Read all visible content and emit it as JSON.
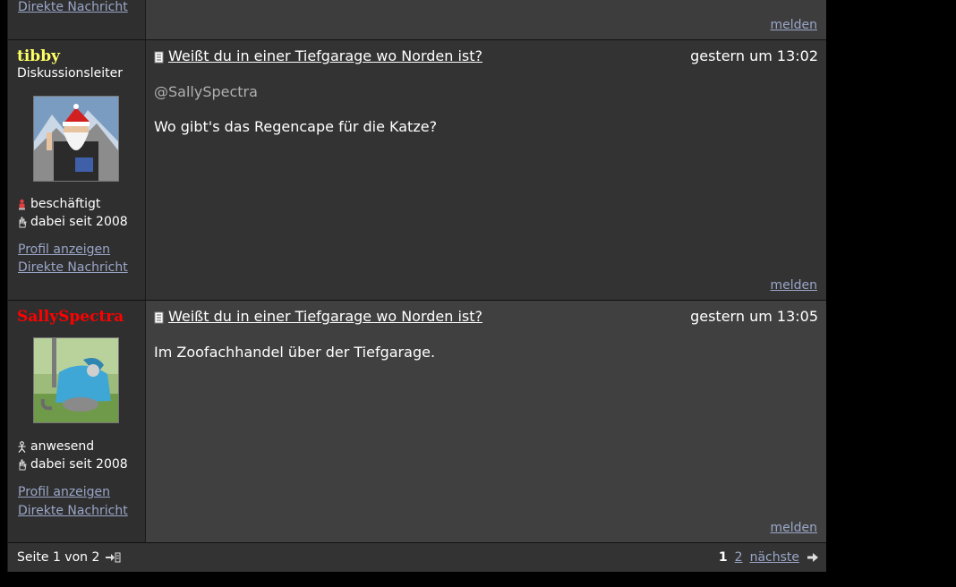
{
  "prev_post": {
    "pm_link": "Direkte Nachricht",
    "report_link": "melden"
  },
  "posts": [
    {
      "username": "tibby",
      "username_color": "#ffff66",
      "rank": "Diskussionsleiter",
      "status": "beschäftigt",
      "status_icon": "busy-person-icon",
      "member_since": "dabei seit 2008",
      "profile_link": "Profil anzeigen",
      "pm_link": "Direkte Nachricht",
      "title": "Weißt du in einer Tiefgarage wo Norden ist?",
      "date": "gestern um 13:02",
      "mention": "@SallySpectra",
      "text": "Wo gibt's das Regencape für die Katze?",
      "report_link": "melden"
    },
    {
      "username": "SallySpectra",
      "username_color": "#ff0000",
      "status": "anwesend",
      "status_icon": "present-person-icon",
      "member_since": "dabei seit 2008",
      "profile_link": "Profil anzeigen",
      "pm_link": "Direkte Nachricht",
      "title": "Weißt du in einer Tiefgarage wo Norden ist?",
      "date": "gestern um 13:05",
      "text": "Im Zoofachhandel über der Tiefgarage.",
      "report_link": "melden"
    }
  ],
  "pagination": {
    "summary": "Seite 1 von 2",
    "current": "1",
    "pages": [
      "2"
    ],
    "next": "nächste"
  }
}
